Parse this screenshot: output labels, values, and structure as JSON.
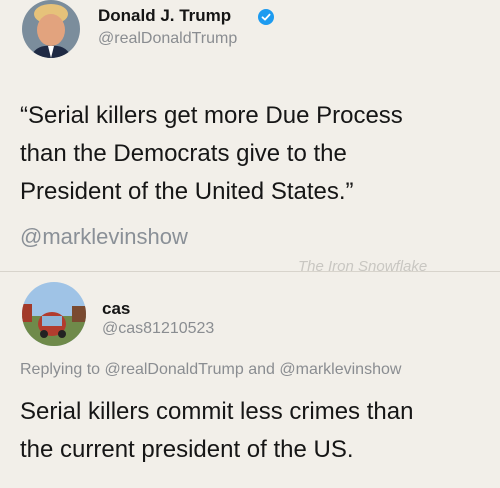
{
  "tweet_original": {
    "display_name": "Donald J. Trump",
    "handle": "@realDonaldTrump",
    "verified": true,
    "text_lines": [
      "“Serial killers get more Due Process",
      "than the Democrats give to the",
      "President of the United States.”"
    ],
    "mention": "@marklevinshow"
  },
  "watermark": "The Iron Snowflake",
  "tweet_reply": {
    "display_name": "cas",
    "handle": "@cas81210523",
    "replying_prefix": "Replying to",
    "replying_user_1": "@realDonaldTrump",
    "replying_and": "and",
    "replying_user_2": "@marklevinshow",
    "text_lines": [
      "Serial killers commit less crimes than",
      "the current president of the US."
    ]
  },
  "colors": {
    "background": "#f2efe9",
    "muted_text": "#8a8d91",
    "verified_badge": "#1d9bf0"
  },
  "icons": {
    "verified": "verified-badge-icon"
  }
}
